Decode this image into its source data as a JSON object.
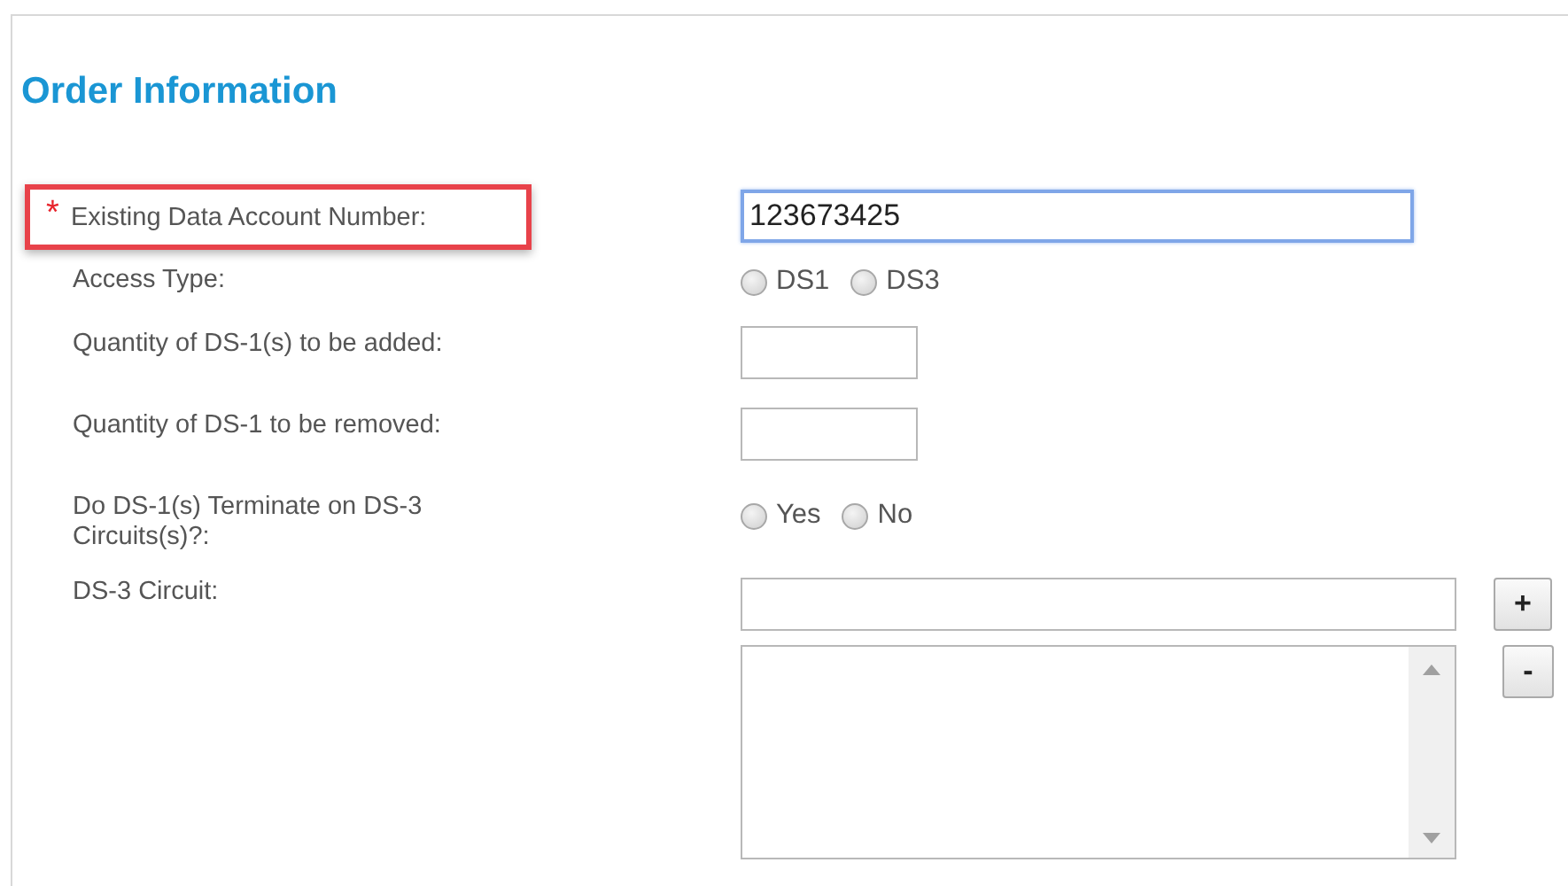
{
  "section": {
    "title": "Order Information"
  },
  "fields": [
    {
      "kind": "text",
      "label": "Existing Data Account Number:",
      "required_mark": "*",
      "highlighted": true,
      "value": "123673425",
      "focused": true,
      "wide": true
    },
    {
      "kind": "radio",
      "label": "Access Type:",
      "options": [
        {
          "label": "DS1",
          "selected": false
        },
        {
          "label": "DS3",
          "selected": false
        }
      ]
    },
    {
      "kind": "text",
      "label": "Quantity of DS-1(s) to be added:",
      "highlighted": false,
      "focused": false,
      "wide": false
    },
    {
      "kind": "text",
      "label": "Quantity of DS-1 to be removed:",
      "highlighted": false,
      "focused": false,
      "wide": false
    },
    {
      "kind": "radio",
      "label": "Do DS-1(s) Terminate on DS-3 Circuits(s)?:",
      "options": [
        {
          "label": "Yes",
          "selected": false
        },
        {
          "label": "No",
          "selected": false
        }
      ]
    },
    {
      "kind": "list",
      "label": "DS-3 Circuit:",
      "add_button": "+",
      "remove_button": "-"
    }
  ]
}
